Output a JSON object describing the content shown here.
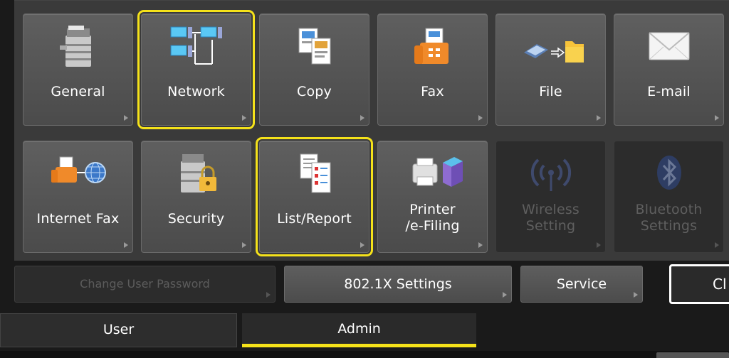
{
  "tiles": [
    {
      "label": "General",
      "icon": "copier-icon",
      "state": "normal"
    },
    {
      "label": "Network",
      "icon": "network-icon",
      "state": "selected"
    },
    {
      "label": "Copy",
      "icon": "copy-documents-icon",
      "state": "normal"
    },
    {
      "label": "Fax",
      "icon": "fax-machine-icon",
      "state": "normal"
    },
    {
      "label": "File",
      "icon": "scan-to-folder-icon",
      "state": "normal"
    },
    {
      "label": "E-mail",
      "icon": "envelope-icon",
      "state": "normal"
    },
    {
      "label": "Internet Fax",
      "icon": "internet-fax-icon",
      "state": "normal"
    },
    {
      "label": "Security",
      "icon": "copier-lock-icon",
      "state": "normal"
    },
    {
      "label": "List/Report",
      "icon": "report-list-icon",
      "state": "selected"
    },
    {
      "label_line1": "Printer",
      "label_line2": "/e-Filing",
      "icon": "printer-box-icon",
      "state": "normal"
    },
    {
      "label_line1": "Wireless",
      "label_line2": "Setting",
      "icon": "wireless-icon",
      "state": "disabled"
    },
    {
      "label_line1": "Bluetooth",
      "label_line2": "Settings",
      "icon": "bluetooth-icon",
      "state": "disabled"
    }
  ],
  "buttons": {
    "change_password": "Change User Password",
    "dot1x": "802.1X Settings",
    "service": "Service",
    "close": "Cl"
  },
  "tabs": {
    "user": "User",
    "admin": "Admin",
    "active": "Admin"
  },
  "colors": {
    "selected_outline": "#f5e21a",
    "tile_bg": "#555555",
    "disabled_bg": "#2c2c2c"
  }
}
